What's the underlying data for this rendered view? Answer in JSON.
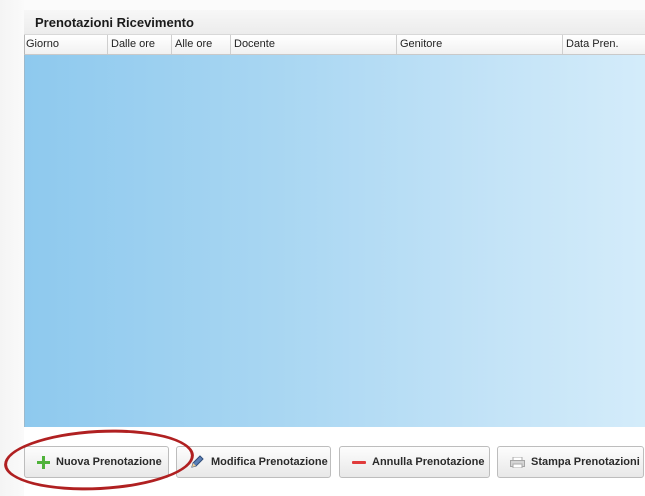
{
  "panel": {
    "title": "Prenotazioni Ricevimento"
  },
  "table": {
    "columns": [
      {
        "label": "Giorno"
      },
      {
        "label": "Dalle ore"
      },
      {
        "label": "Alle ore"
      },
      {
        "label": "Docente"
      },
      {
        "label": "Genitore"
      },
      {
        "label": "Data Pren."
      }
    ],
    "rows": []
  },
  "toolbar": {
    "new_label": "Nuova Prenotazione",
    "edit_label": "Modifica Prenotazione",
    "cancel_label": "Annulla Prenotazione",
    "print_label": "Stampa Prenotazioni"
  },
  "colors": {
    "grid_background": "#a8d6f2",
    "highlight_circle": "#b02021",
    "add_icon": "#4fb23a",
    "remove_icon": "#e03b3b"
  },
  "icons": {
    "new": "plus-icon",
    "edit": "pencil-icon",
    "cancel": "minus-icon",
    "print": "printer-icon"
  }
}
